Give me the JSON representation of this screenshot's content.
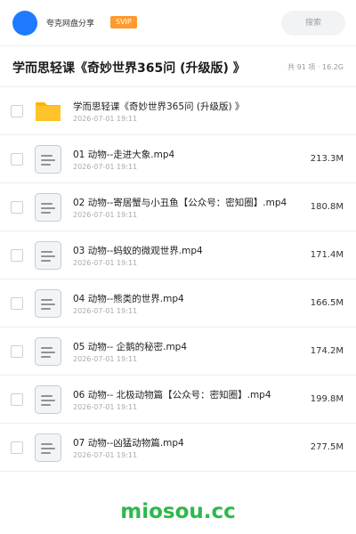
{
  "header": {
    "user_name": "夸克网盘分享",
    "vip_badge": "SVIP",
    "search_placeholder": "搜索"
  },
  "folder": {
    "title": "学而思轻课《奇妙世界365问 (升级版) 》",
    "summary": "共 91 项 · 16.2G"
  },
  "files": [
    {
      "name": "学而思轻课《奇妙世界365问 (升级版) 》",
      "date": "2026-07-01 19:11",
      "size": "",
      "icon": "folder-icon"
    },
    {
      "name": "01 动物--走进大象.mp4",
      "date": "2026-07-01 19:11",
      "size": "213.3M",
      "icon": "file-icon"
    },
    {
      "name": "02 动物--寄居蟹与小丑鱼【公众号：密知圈】.mp4",
      "date": "2026-07-01 19:11",
      "size": "180.8M",
      "icon": "file-icon"
    },
    {
      "name": "03 动物--蚂蚁的微观世界.mp4",
      "date": "2026-07-01 19:11",
      "size": "171.4M",
      "icon": "file-icon"
    },
    {
      "name": "04 动物--熊类的世界.mp4",
      "date": "2026-07-01 19:11",
      "size": "166.5M",
      "icon": "file-icon"
    },
    {
      "name": "05 动物-- 企鹅的秘密.mp4",
      "date": "2026-07-01 19:11",
      "size": "174.2M",
      "icon": "file-icon"
    },
    {
      "name": "06 动物-- 北极动物篇【公众号：密知圈】.mp4",
      "date": "2026-07-01 19:11",
      "size": "199.8M",
      "icon": "file-icon"
    },
    {
      "name": "07 动物--凶猛动物篇.mp4",
      "date": "2026-07-01 19:11",
      "size": "277.5M",
      "icon": "file-icon"
    }
  ],
  "watermark": "miosou.cc",
  "colors": {
    "avatar": "#1e7bff",
    "vip_badge": "#ff9a2e",
    "folder": "#ffc42a",
    "watermark": "#2db84d"
  }
}
